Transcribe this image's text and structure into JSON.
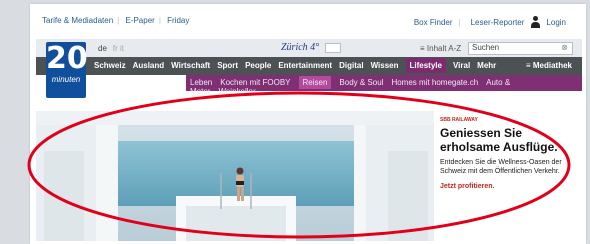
{
  "topbar": {
    "left_links": [
      "Tarife & Mediadaten",
      "E-Paper",
      "Friday"
    ],
    "box_finder": "Box Finder",
    "leser_reporter": "Leser-Reporter",
    "login": "Login"
  },
  "header": {
    "logo_number": "20",
    "logo_word": "minuten",
    "lang_selected": "de",
    "lang_others": "fr  it",
    "weather_city": "Zürich 4°",
    "inhalt_label": "Inhalt A-Z",
    "search_placeholder": "Suchen"
  },
  "nav_main": {
    "items": [
      "Schweiz",
      "Ausland",
      "Wirtschaft",
      "Sport",
      "People",
      "Entertainment",
      "Digital",
      "Wissen",
      "Lifestyle",
      "Viral",
      "Mehr"
    ],
    "active_index": 8,
    "right_label": "Mediathek"
  },
  "nav_sub": {
    "items": [
      "Leben",
      "Kochen mit FOOBY",
      "Reisen",
      "Body & Soul",
      "Homes mit homegate.ch",
      "Auto & Motor",
      "Weinkeller"
    ],
    "active_index": 2
  },
  "teaser": {
    "kicker": "SBB RAILAWAY",
    "title": "Geniessen Sie erholsame Ausflüge.",
    "text": "Entdecken Sie die Wellness-Oasen der Schweiz mit dem Öffentlichen Verkehr.",
    "cta": "Jetzt profitieren."
  },
  "colors": {
    "brand_blue": "#104f9b",
    "nav_dark": "#4c5154",
    "lifestyle_purple": "#7f2f73",
    "annotation_red": "#e0001a"
  },
  "icons": [
    "user-icon",
    "search-clear-icon",
    "menu-icon",
    "annotation-ellipse"
  ]
}
